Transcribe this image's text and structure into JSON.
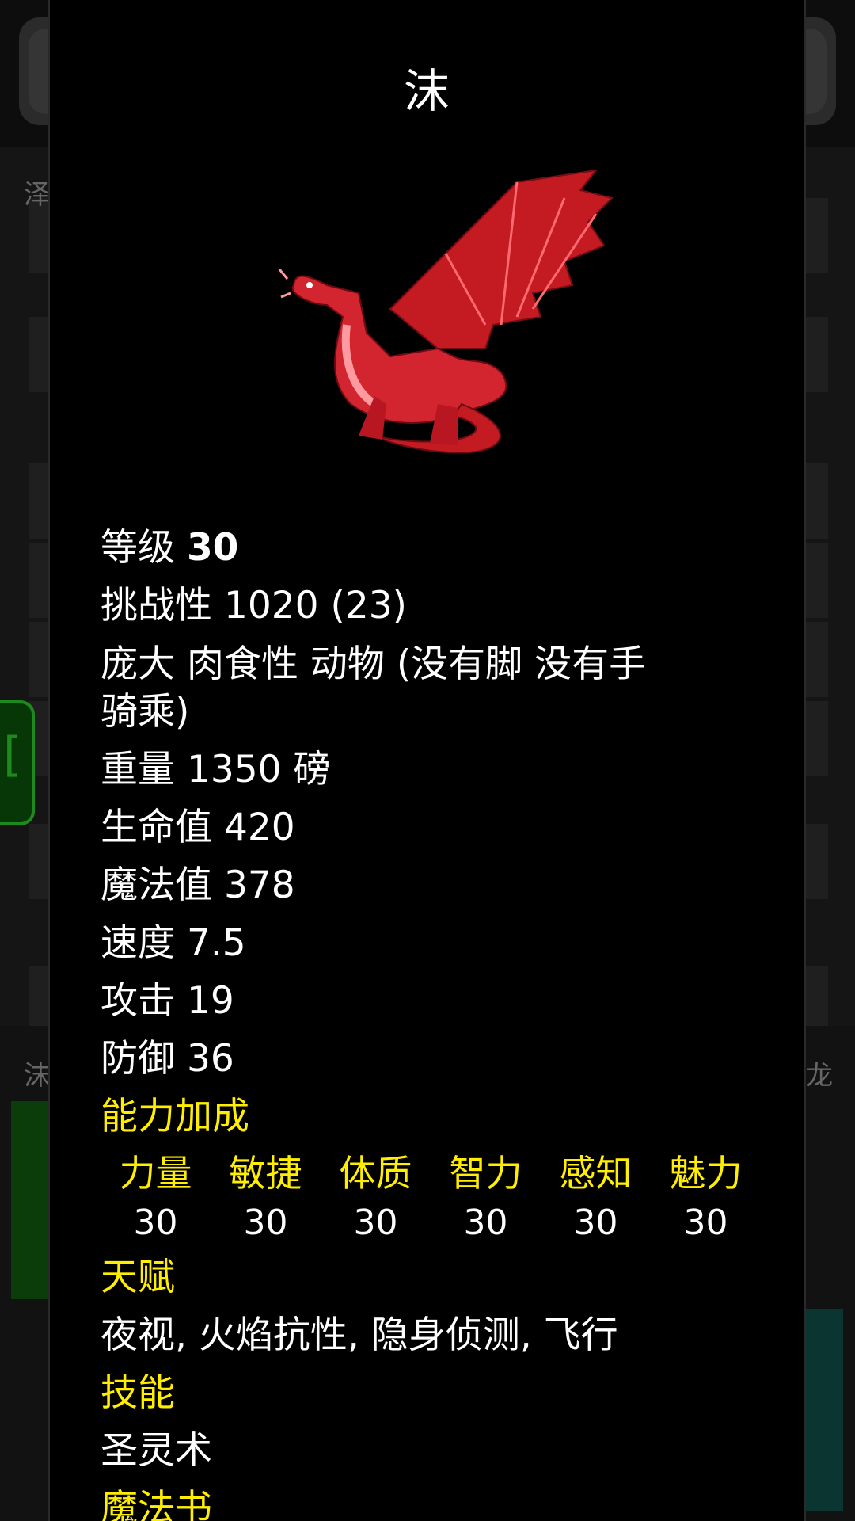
{
  "background": {
    "labels": [
      "泽",
      "沫",
      "龙"
    ]
  },
  "monster": {
    "name": "沫",
    "portrait_icon": "red-dragon-icon",
    "level_label": "等级",
    "level_value": "30",
    "challenge": "挑战性 1020 (23)",
    "traits_line1": "庞大 肉食性 动物 (没有脚 没有手",
    "traits_line2": "骑乘)",
    "weight": "重量 1350 磅",
    "hp": "生命值 420",
    "mp": "魔法值 378",
    "speed": "速度 7.5",
    "attack": "攻击 19",
    "defense": "防御 36"
  },
  "ability_bonus": {
    "heading": "能力加成",
    "attributes": [
      {
        "name": "力量",
        "value": "30"
      },
      {
        "name": "敏捷",
        "value": "30"
      },
      {
        "name": "体质",
        "value": "30"
      },
      {
        "name": "智力",
        "value": "30"
      },
      {
        "name": "感知",
        "value": "30"
      },
      {
        "name": "魅力",
        "value": "30"
      }
    ]
  },
  "talents": {
    "heading": "天赋",
    "text": "夜视, 火焰抗性, 隐身侦测, 飞行"
  },
  "skills": {
    "heading": "技能",
    "text": "圣灵术"
  },
  "spellbook": {
    "heading": "魔法书"
  }
}
